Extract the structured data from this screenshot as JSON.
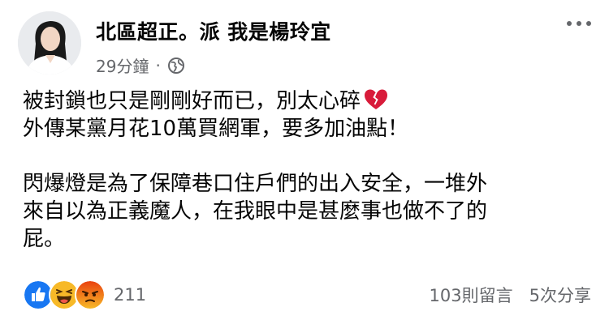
{
  "post": {
    "author": "北區超正。派 我是楊玲宜",
    "time": "29分鐘",
    "separator": "·",
    "lines": [
      "被封鎖也只是剛剛好而已，別太心碎",
      "外傳某黨月花10萬買網軍，要多加油點！",
      "閃爆燈是為了保障巷口住戶們的出入安全，一堆外",
      "來自以為正義魔人，在我眼中是甚麼事也做不了的",
      "屁。"
    ]
  },
  "footer": {
    "reaction_count": "211",
    "comments": "103則留言",
    "shares": "5次分享"
  },
  "icons": {
    "privacy": "globe-icon",
    "emoji": "broken-heart-icon",
    "reactions": [
      "like-icon",
      "haha-icon",
      "angry-icon"
    ],
    "menu": "more-options-icon"
  },
  "colors": {
    "like_blue": "#1877f2",
    "haha_yellow": "#f7b928",
    "angry_orange": "#e9710f",
    "heart_red": "#d81b3a",
    "meta_gray": "#65676b"
  }
}
